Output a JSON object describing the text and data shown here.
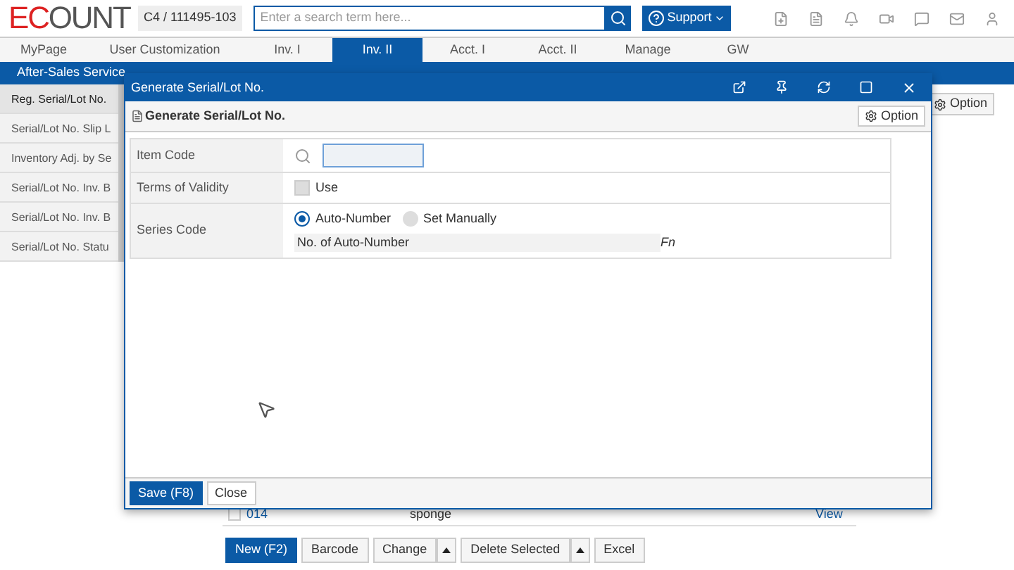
{
  "header": {
    "logo": "ECOUNT",
    "company": "C4 / 111495-103",
    "search": {
      "placeholder": "Enter a search term here..."
    },
    "support": "Support"
  },
  "nav": [
    {
      "label": "MyPage",
      "selected": false
    },
    {
      "label": "User Customization",
      "selected": false
    },
    {
      "label": "Inv. I",
      "selected": false
    },
    {
      "label": "Inv. II",
      "selected": true
    },
    {
      "label": "Acct. I",
      "selected": false
    },
    {
      "label": "Acct. II",
      "selected": false
    },
    {
      "label": "Manage",
      "selected": false
    },
    {
      "label": "GW",
      "selected": false
    }
  ],
  "subnav": [
    "After-Sales Service"
  ],
  "sidebar": {
    "items": [
      {
        "label": "Reg. Serial/Lot No.",
        "selected": true
      },
      {
        "label": "Serial/Lot No. Slip L",
        "selected": false
      },
      {
        "label": "Inventory Adj. by Se",
        "selected": false
      },
      {
        "label": "Serial/Lot No. Inv. B",
        "selected": false
      },
      {
        "label": "Serial/Lot No. Inv. B",
        "selected": false
      },
      {
        "label": "Serial/Lot No. Statu",
        "selected": false
      }
    ]
  },
  "page_option": "Option",
  "table": {
    "row": {
      "checked": false,
      "code": "014",
      "name": "sponge",
      "link": "View"
    }
  },
  "toolbar": [
    "New (F2)",
    "Barcode",
    "Change",
    "Delete Selected",
    "Excel"
  ],
  "dialog": {
    "title": "Generate Serial/Lot No.",
    "heading": "Generate Serial/Lot No.",
    "option": "Option",
    "fields": [
      {
        "kind": "search",
        "label": "Item Code"
      },
      {
        "kind": "checkbox",
        "label": "Terms of Validity",
        "option": "Use",
        "checked": false
      },
      {
        "kind": "radio",
        "label": "Series Code",
        "options": [
          {
            "label": "Auto-Number",
            "selected": true
          },
          {
            "label": "Set Manually",
            "selected": false
          }
        ],
        "sublabel": "No. of Auto-Number",
        "fn": "Fn"
      }
    ],
    "buttons": [
      "Save (F8)",
      "Close"
    ]
  }
}
